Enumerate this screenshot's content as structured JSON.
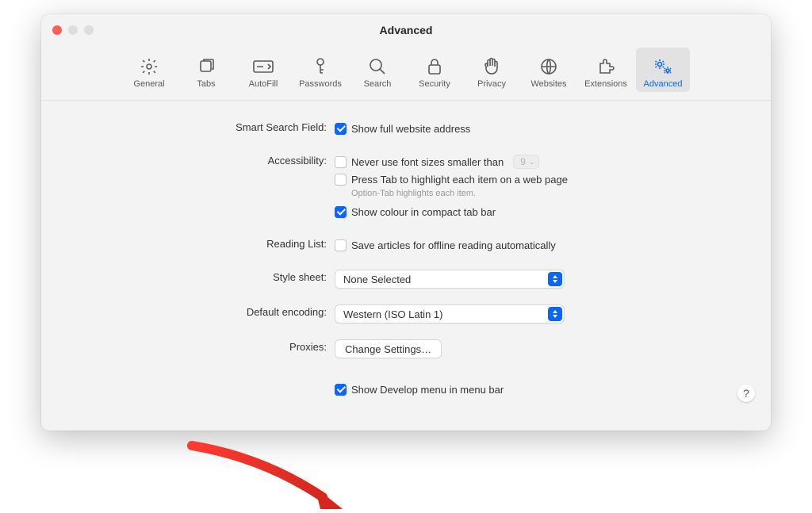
{
  "window": {
    "title": "Advanced"
  },
  "toolbar": {
    "items": [
      {
        "label": "General"
      },
      {
        "label": "Tabs"
      },
      {
        "label": "AutoFill"
      },
      {
        "label": "Passwords"
      },
      {
        "label": "Search"
      },
      {
        "label": "Security"
      },
      {
        "label": "Privacy"
      },
      {
        "label": "Websites"
      },
      {
        "label": "Extensions"
      },
      {
        "label": "Advanced"
      }
    ]
  },
  "sections": {
    "smart_search": {
      "label": "Smart Search Field:",
      "show_full_address": {
        "checked": true,
        "text": "Show full website address"
      }
    },
    "accessibility": {
      "label": "Accessibility:",
      "never_font_smaller": {
        "checked": false,
        "text": "Never use font sizes smaller than",
        "value": "9"
      },
      "press_tab": {
        "checked": false,
        "text": "Press Tab to highlight each item on a web page",
        "hint": "Option-Tab highlights each item."
      },
      "show_colour": {
        "checked": true,
        "text": "Show colour in compact tab bar"
      }
    },
    "reading_list": {
      "label": "Reading List:",
      "save_offline": {
        "checked": false,
        "text": "Save articles for offline reading automatically"
      }
    },
    "style_sheet": {
      "label": "Style sheet:",
      "value": "None Selected"
    },
    "default_encoding": {
      "label": "Default encoding:",
      "value": "Western (ISO Latin 1)"
    },
    "proxies": {
      "label": "Proxies:",
      "button": "Change Settings…"
    },
    "develop": {
      "checked": true,
      "text": "Show Develop menu in menu bar"
    }
  },
  "help": "?"
}
